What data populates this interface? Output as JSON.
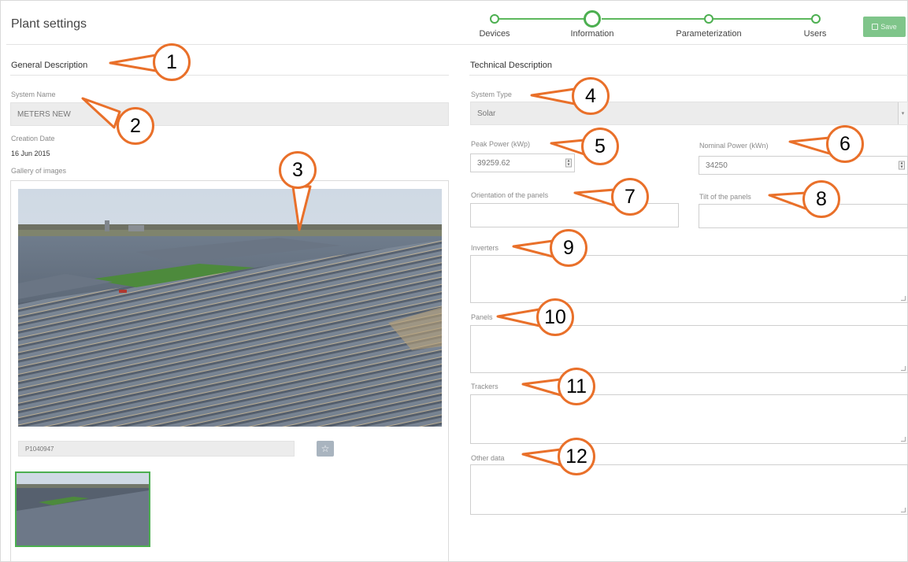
{
  "header": {
    "title": "Plant settings",
    "steps": [
      {
        "label": "Devices",
        "active": false
      },
      {
        "label": "Information",
        "active": true
      },
      {
        "label": "Parameterization",
        "active": false
      },
      {
        "label": "Users",
        "active": false
      }
    ],
    "save_label": "Save"
  },
  "general": {
    "heading": "General Description",
    "system_name_label": "System Name",
    "system_name_value": "METERS NEW",
    "creation_date_label": "Creation Date",
    "creation_date_value": "16 Jun 2015",
    "gallery_label": "Gallery of images",
    "image_caption_value": "P1040947"
  },
  "technical": {
    "heading": "Technical Description",
    "system_type_label": "System Type",
    "system_type_value": "Solar",
    "peak_power_label": "Peak Power (kWp)",
    "peak_power_value": "39259.62",
    "nominal_power_label": "Nominal Power (kWn)",
    "nominal_power_value": "34250",
    "orientation_label": "Orientation of the panels",
    "tilt_label": "Tilt of the panels",
    "inverters_label": "Inverters",
    "panels_label": "Panels",
    "trackers_label": "Trackers",
    "other_label": "Other data"
  },
  "callouts": [
    "1",
    "2",
    "3",
    "4",
    "5",
    "6",
    "7",
    "8",
    "9",
    "10",
    "11",
    "12"
  ],
  "colors": {
    "accent_green": "#4caf50",
    "save_button": "#7fc58a",
    "callout_orange": "#e9702a"
  },
  "icons": [
    "save-icon",
    "star-icon",
    "spinner-icon",
    "caret-down-icon"
  ]
}
